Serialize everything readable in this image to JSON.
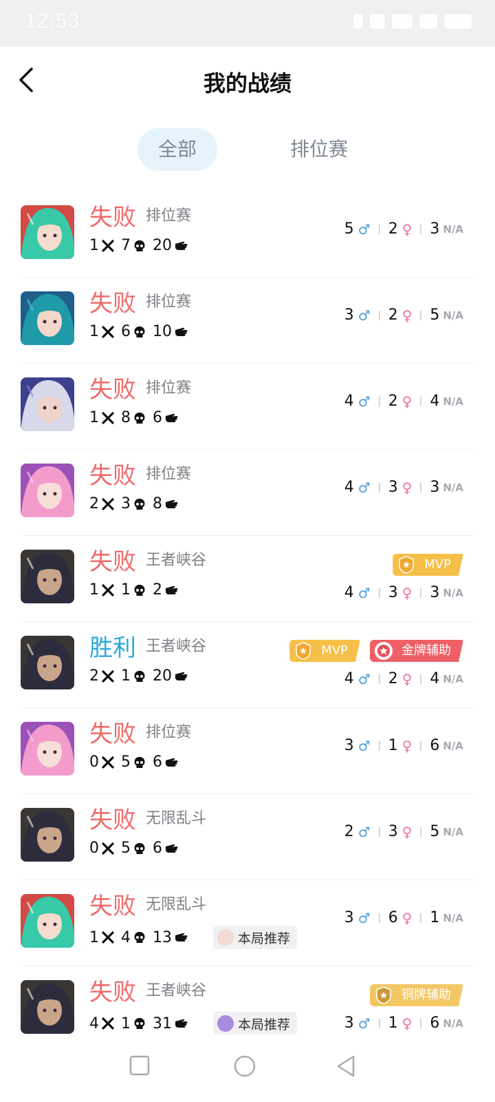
{
  "status_bar": {
    "time": "12:53"
  },
  "header": {
    "title": "我的战绩"
  },
  "tabs": [
    {
      "label": "全部",
      "selected": true
    },
    {
      "label": "排位赛",
      "selected": false
    }
  ],
  "gender_suffix": {
    "na": "N/A"
  },
  "colors": {
    "loss": "#ee6b6b",
    "win": "#2aa8dd",
    "tab_active_bg": "#e5f3fb"
  },
  "matches": [
    {
      "result": "失败",
      "mode": "排位赛",
      "kills": "1",
      "deaths": "7",
      "assists": "20",
      "male": "5",
      "female": "2",
      "na": "3",
      "avatar": "hero-green-hair"
    },
    {
      "result": "失败",
      "mode": "排位赛",
      "kills": "1",
      "deaths": "6",
      "assists": "10",
      "male": "3",
      "female": "2",
      "na": "5",
      "avatar": "hero-teal-girl"
    },
    {
      "result": "失败",
      "mode": "排位赛",
      "kills": "1",
      "deaths": "8",
      "assists": "6",
      "male": "4",
      "female": "2",
      "na": "4",
      "avatar": "hero-silver-hair"
    },
    {
      "result": "失败",
      "mode": "排位赛",
      "kills": "2",
      "deaths": "3",
      "assists": "8",
      "male": "4",
      "female": "3",
      "na": "3",
      "avatar": "hero-pink-hair"
    },
    {
      "result": "失败",
      "mode": "王者峡谷",
      "kills": "1",
      "deaths": "1",
      "assists": "2",
      "male": "4",
      "female": "3",
      "na": "3",
      "avatar": "hero-dark-hair",
      "badges": [
        {
          "type": "mvp",
          "label": "MVP"
        }
      ]
    },
    {
      "result": "胜利",
      "mode": "王者峡谷",
      "kills": "2",
      "deaths": "1",
      "assists": "20",
      "male": "4",
      "female": "2",
      "na": "4",
      "avatar": "hero-dark-hair",
      "badges": [
        {
          "type": "mvp",
          "label": "MVP"
        },
        {
          "type": "gold",
          "label": "金牌辅助"
        }
      ]
    },
    {
      "result": "失败",
      "mode": "排位赛",
      "kills": "0",
      "deaths": "5",
      "assists": "6",
      "male": "3",
      "female": "1",
      "na": "6",
      "avatar": "hero-pink-hair"
    },
    {
      "result": "失败",
      "mode": "无限乱斗",
      "kills": "0",
      "deaths": "5",
      "assists": "6",
      "male": "2",
      "female": "3",
      "na": "5",
      "avatar": "hero-dark-hair"
    },
    {
      "result": "失败",
      "mode": "无限乱斗",
      "kills": "1",
      "deaths": "4",
      "assists": "13",
      "male": "3",
      "female": "6",
      "na": "1",
      "avatar": "hero-green-hair",
      "recommend": "本局推荐"
    },
    {
      "result": "失败",
      "mode": "王者峡谷",
      "kills": "4",
      "deaths": "1",
      "assists": "31",
      "male": "3",
      "female": "1",
      "na": "6",
      "avatar": "hero-dark-hair",
      "recommend": "本局推荐",
      "badges": [
        {
          "type": "bronze",
          "label": "铜牌辅助"
        }
      ]
    }
  ]
}
